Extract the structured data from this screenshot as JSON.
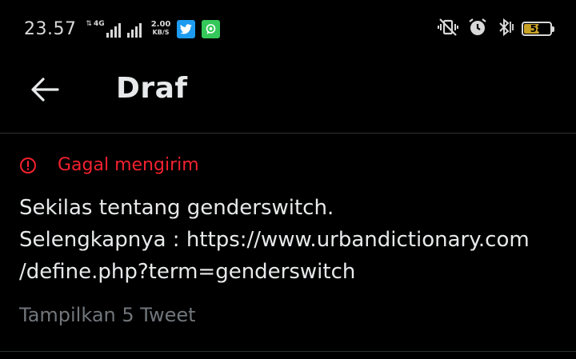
{
  "status_bar": {
    "time": "23.57",
    "network_type": "4G",
    "net_speed_value": "2.00",
    "net_speed_unit": "KB/S",
    "battery_level": 58,
    "battery_text": "58",
    "icons": [
      "signal-bars-icon",
      "twitter-app-icon",
      "messaging-app-icon",
      "vibrate-icon",
      "alarm-icon",
      "bluetooth-icon",
      "battery-icon"
    ]
  },
  "header": {
    "title": "Draf",
    "back_icon": "arrow-left-icon"
  },
  "draft": {
    "error_icon": "alert-circle-icon",
    "error_label": "Gagal mengirim",
    "text": "Sekilas tentang genderswitch.\nSelengkapnya : https://www.urbandictionary.com\n/define.php?term=genderswitch",
    "thread_count": "Tampilkan 5 Tweet"
  },
  "colors": {
    "background": "#000000",
    "text": "#e7e9ea",
    "muted": "#71767b",
    "error": "#f4212e",
    "divider": "#2f3336",
    "battery_fill": "#c9a227"
  }
}
